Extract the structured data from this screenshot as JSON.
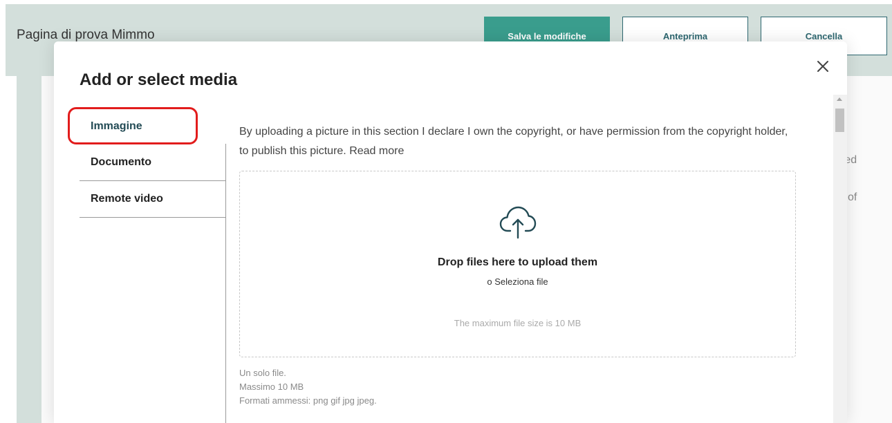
{
  "header": {
    "title": "Pagina di prova Mimmo",
    "save_label": "Salva le modifiche",
    "preview_label": "Anteprima",
    "cancel_label": "Cancella"
  },
  "background": {
    "text_fragment_1": "rked",
    "text_fragment_2": "of"
  },
  "modal": {
    "title": "Add or select media",
    "tabs": [
      {
        "label": "Immagine",
        "active": true
      },
      {
        "label": "Documento",
        "active": false
      },
      {
        "label": "Remote video",
        "active": false
      }
    ],
    "declaration": "By uploading a picture in this section I declare I own the copyright, or have permission from the copyright holder, to publish this picture. Read more",
    "dropzone": {
      "main_text": "Drop files here to upload them",
      "select_text": "o Seleziona file",
      "max_size_text": "The maximum file size is 10 MB"
    },
    "rules": [
      "Un solo file.",
      "Massimo 10 MB",
      "Formati ammessi: png gif jpg jpeg."
    ]
  },
  "icons": {
    "close": "close-icon",
    "upload": "cloud-upload-icon"
  },
  "colors": {
    "accent": "#3a9d8d",
    "header_bg": "#d3dfdb",
    "highlight": "#e21c1c",
    "tab_active": "#234b55"
  }
}
